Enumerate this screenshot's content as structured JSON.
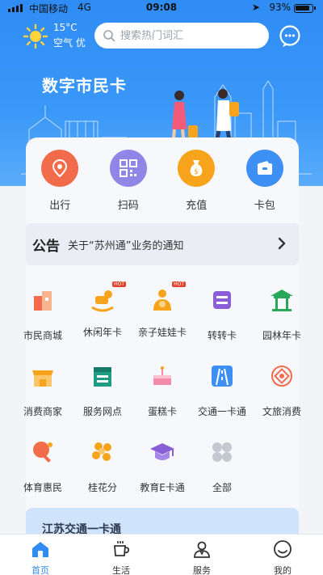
{
  "status_bar": {
    "carrier": "中国移动",
    "network": "4G",
    "time": "09:08",
    "battery": "93%"
  },
  "weather": {
    "temperature": "15°C",
    "air_quality": "空气 优"
  },
  "search": {
    "placeholder": "搜索热门词汇"
  },
  "banner": {
    "title": "数字市民卡"
  },
  "quick_actions": [
    {
      "label": "出行",
      "icon": "location-pin-icon",
      "color": "#f26b4b"
    },
    {
      "label": "扫码",
      "icon": "qr-code-icon",
      "color": "#8f86e8"
    },
    {
      "label": "充值",
      "icon": "money-bag-icon",
      "color": "#f7a31c"
    },
    {
      "label": "卡包",
      "icon": "wallet-icon",
      "color": "#3e8ff4"
    }
  ],
  "notice": {
    "tag": "公告",
    "text": "关于“苏州通”业务的通知"
  },
  "services": [
    {
      "label": "市民商城",
      "icon": "mall-icon"
    },
    {
      "label": "休闲年卡",
      "icon": "rocking-horse-icon",
      "badge": "HOT"
    },
    {
      "label": "亲子娃娃卡",
      "icon": "parent-child-icon",
      "badge": "HOT"
    },
    {
      "label": "转转卡",
      "icon": "transfer-card-icon"
    },
    {
      "label": "园林年卡",
      "icon": "pavilion-icon"
    },
    {
      "label": "消费商家",
      "icon": "shop-icon"
    },
    {
      "label": "服务网点",
      "icon": "service-point-icon"
    },
    {
      "label": "蛋糕卡",
      "icon": "cake-icon"
    },
    {
      "label": "交通一卡通",
      "icon": "road-icon"
    },
    {
      "label": "文旅消费",
      "icon": "culture-icon"
    },
    {
      "label": "体育惠民",
      "icon": "ping-pong-icon"
    },
    {
      "label": "桂花分",
      "icon": "osmanthus-icon"
    },
    {
      "label": "教育E卡通",
      "icon": "graduation-cap-icon"
    },
    {
      "label": "全部",
      "icon": "all-apps-icon"
    }
  ],
  "promo": {
    "title": "江苏交通一卡通"
  },
  "tabbar": [
    {
      "label": "首页",
      "icon": "home-icon",
      "active": true
    },
    {
      "label": "生活",
      "icon": "coffee-cup-icon",
      "active": false
    },
    {
      "label": "服务",
      "icon": "service-person-icon",
      "active": false
    },
    {
      "label": "我的",
      "icon": "profile-icon",
      "active": false
    }
  ],
  "colors": {
    "primary": "#2f8cf5"
  }
}
